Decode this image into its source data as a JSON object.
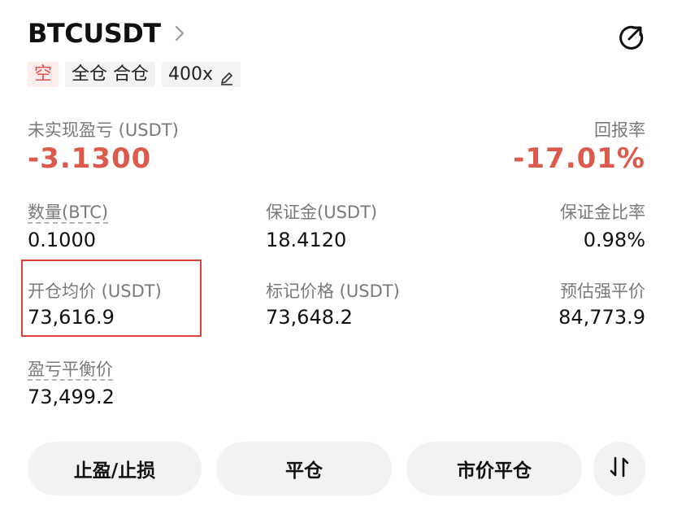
{
  "header": {
    "symbol": "BTCUSDT"
  },
  "tags": {
    "side": "空",
    "margin_mode": "全仓 合仓",
    "leverage": "400x"
  },
  "pnl": {
    "label": "未实现盈亏 (USDT)",
    "value": "-3.1300",
    "roe_label": "回报率",
    "roe_value": "-17.01%"
  },
  "stats": {
    "qty_label": "数量(BTC)",
    "qty_value": "0.1000",
    "margin_label": "保证金(USDT)",
    "margin_value": "18.4120",
    "margin_ratio_label": "保证金比率",
    "margin_ratio_value": "0.98%",
    "entry_label": "开仓均价 (USDT)",
    "entry_value": "73,616.9",
    "mark_label": "标记价格 (USDT)",
    "mark_value": "73,648.2",
    "liq_label": "预估强平价",
    "liq_value": "84,773.9",
    "breakeven_label": "盈亏平衡价",
    "breakeven_value": "73,499.2"
  },
  "actions": {
    "tpsl": "止盈/止损",
    "close": "平仓",
    "market_close": "市价平仓"
  },
  "colors": {
    "loss": "#dc5a4b",
    "short_tag": "#e0534f",
    "highlight_border": "#e0403a",
    "button_bg": "#f2f2f2"
  }
}
